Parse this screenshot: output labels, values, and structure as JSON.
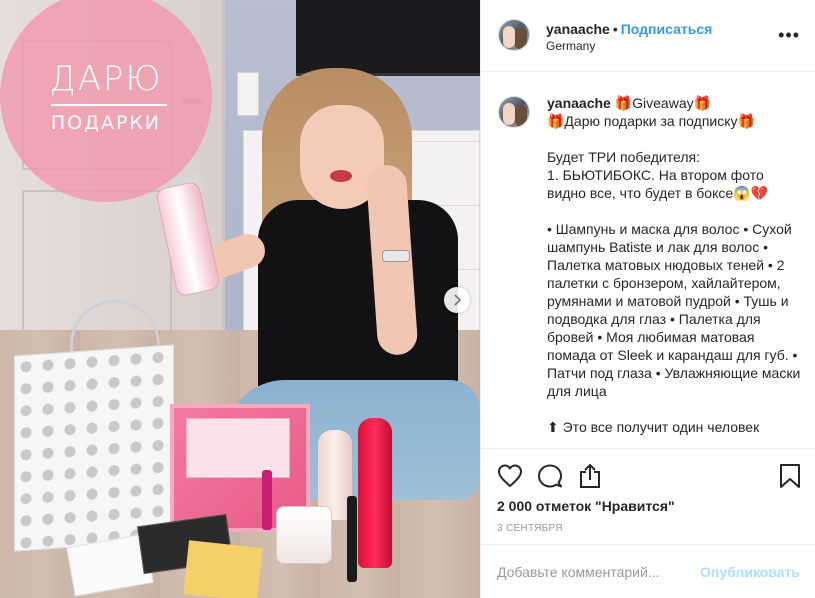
{
  "photo": {
    "badge_line1": "ДАРЮ",
    "badge_line2": "ПОДАРКИ",
    "badge_color": "#f296aa",
    "next_icon": "chevron-right-icon"
  },
  "header": {
    "username": "yanaache",
    "separator": "•",
    "follow_label": "Подписаться",
    "location": "Germany",
    "more_icon": "ellipsis-icon",
    "more_label": "•••"
  },
  "caption": {
    "username": "yanaache",
    "text": "🎁Giveaway🎁\n🎁Дарю подарки за подписку🎁\n\nБудет ТРИ победителя:\n1. БЬЮТИБОКС. На втором фото видно все, что будет в боксе😱💔\n\n• Шампунь и маска для волос • Сухой шампунь Batiste и лак для волос • Палетка матовых нюдовых теней • 2 палетки с бронзером, хайлайтером, румянами и матовой пудрой • Тушь и подводка для глаз • Палетка для бровей • Моя любимая матовая помада от Sleek и карандаш для губ. • Патчи под глаза • Увлажняющие маски для лица\n\n⬆ Это все получит один человек"
  },
  "actions": {
    "like_icon": "heart-icon",
    "comment_icon": "comment-icon",
    "share_icon": "share-icon",
    "save_icon": "bookmark-icon",
    "likes_text": "2 000 отметок \"Нравится\"",
    "date": "3 СЕНТЯБРЯ"
  },
  "comment": {
    "placeholder": "Добавьте комментарий...",
    "post_label": "Опубликовать"
  },
  "colors": {
    "accent": "#3897f0",
    "post_disabled": "#b2dffc",
    "text": "#262626",
    "muted": "#999999"
  }
}
